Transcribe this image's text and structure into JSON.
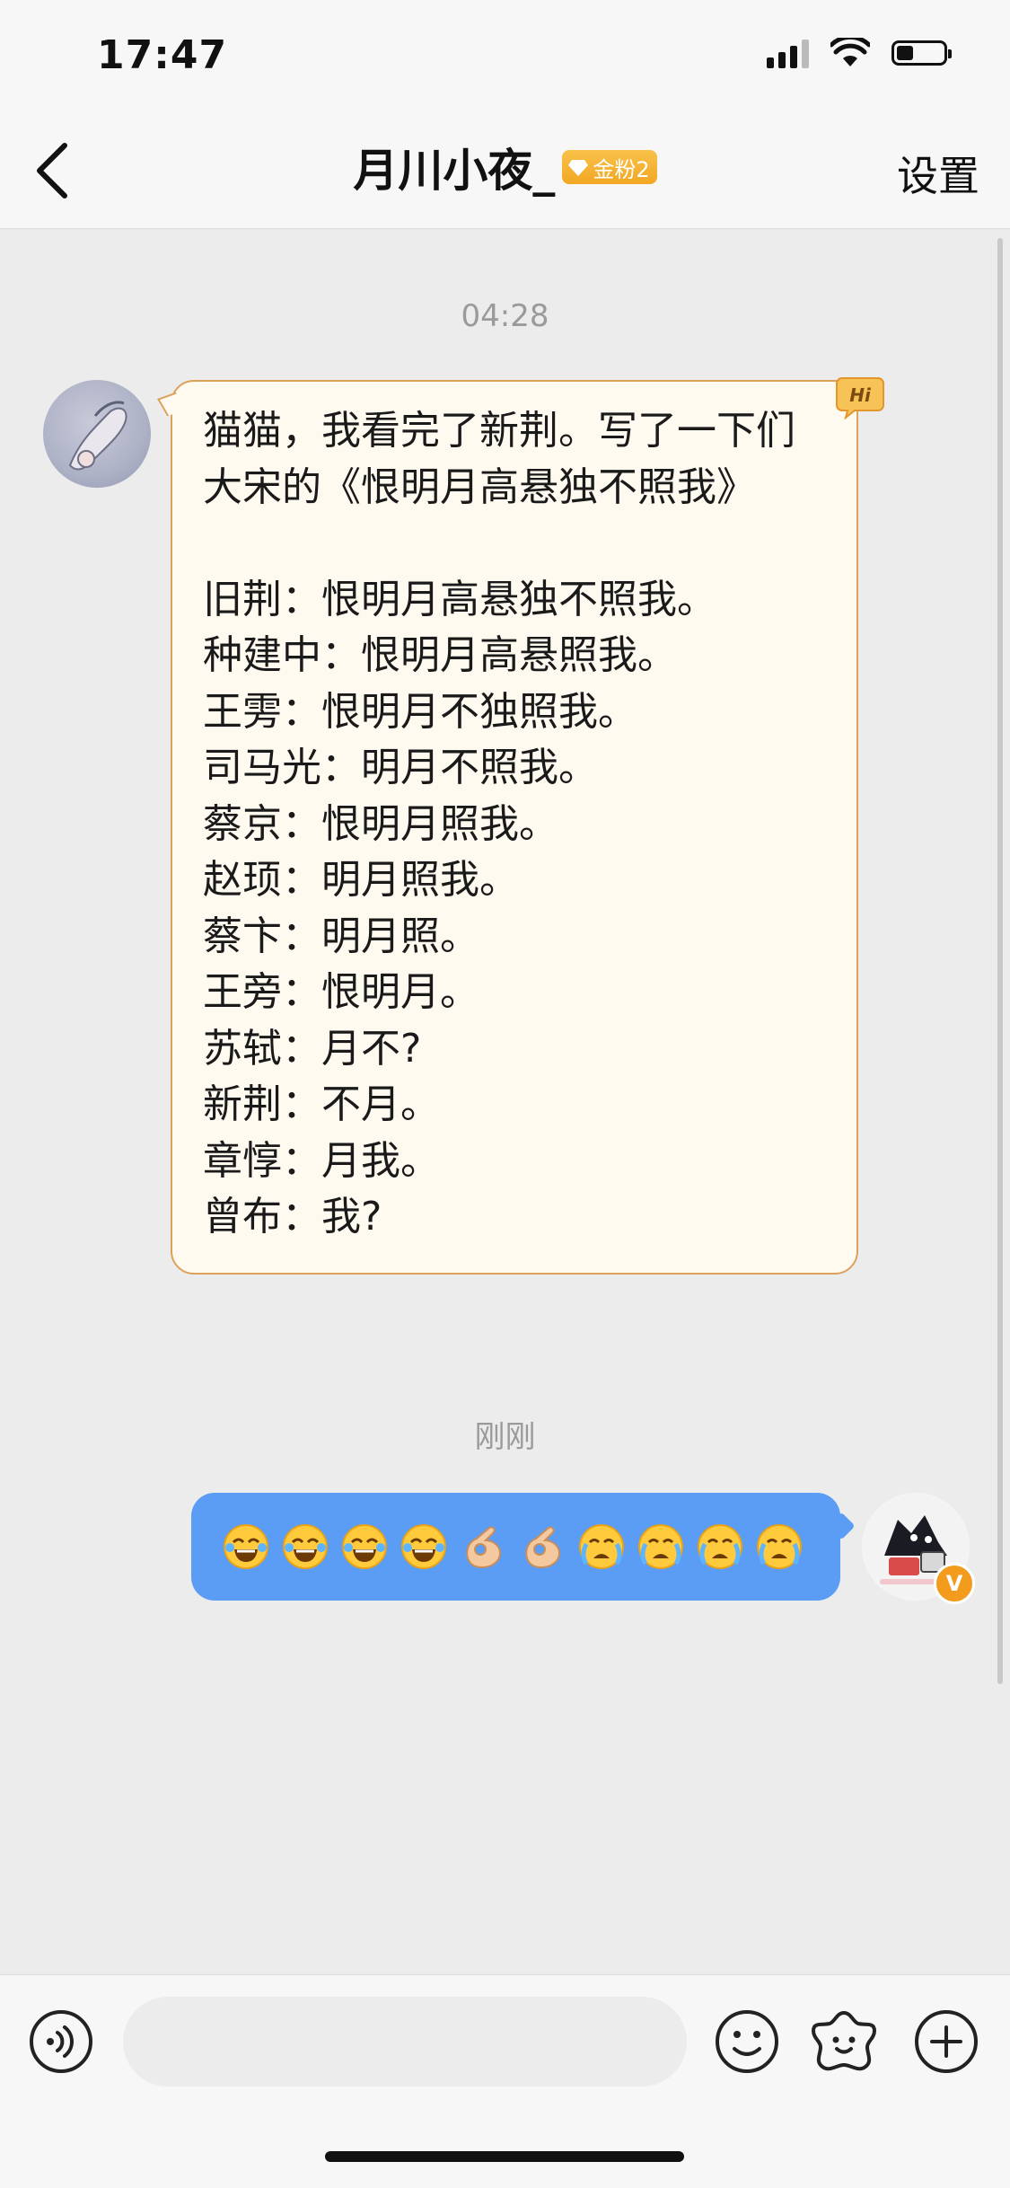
{
  "status_bar": {
    "time": "17:47",
    "battery_level": 0.35
  },
  "nav": {
    "title": "月川小夜_",
    "badge": "金粉2",
    "settings": "设置",
    "back_icon": "chevron-left-icon"
  },
  "chat": {
    "messages": [
      {
        "timestamp": "04:28",
        "sender": "other",
        "text": "猫猫，我看完了新荆。写了一下们大宋的《恨明月高悬独不照我》\n\n旧荆：恨明月高悬独不照我。\n种建中：恨明月高悬照我。\n王雱：恨明月不独照我。\n司马光：明月不照我。\n蔡京：恨明月照我。\n赵顼：明月照我。\n蔡卞：明月照。\n王旁：恨明月。\n苏轼：月不?\n新荆：不月。\n章惇：月我。\n曾布：我?"
      },
      {
        "timestamp": "刚刚",
        "sender": "self",
        "emojis": [
          "😂",
          "😂",
          "😂",
          "😂",
          "👌",
          "👌",
          "😭",
          "😭",
          "😭",
          "😭"
        ]
      }
    ]
  },
  "colors": {
    "outgoing_bubble": "#5b9cf4",
    "incoming_bubble_border": "#dca15a",
    "incoming_bubble_bg": "#fffaf0",
    "badge_gold": "#f2a723"
  },
  "input_bar": {
    "placeholder": "",
    "icons": [
      "voice-icon",
      "emoji-icon",
      "sticker-icon",
      "plus-icon"
    ]
  }
}
